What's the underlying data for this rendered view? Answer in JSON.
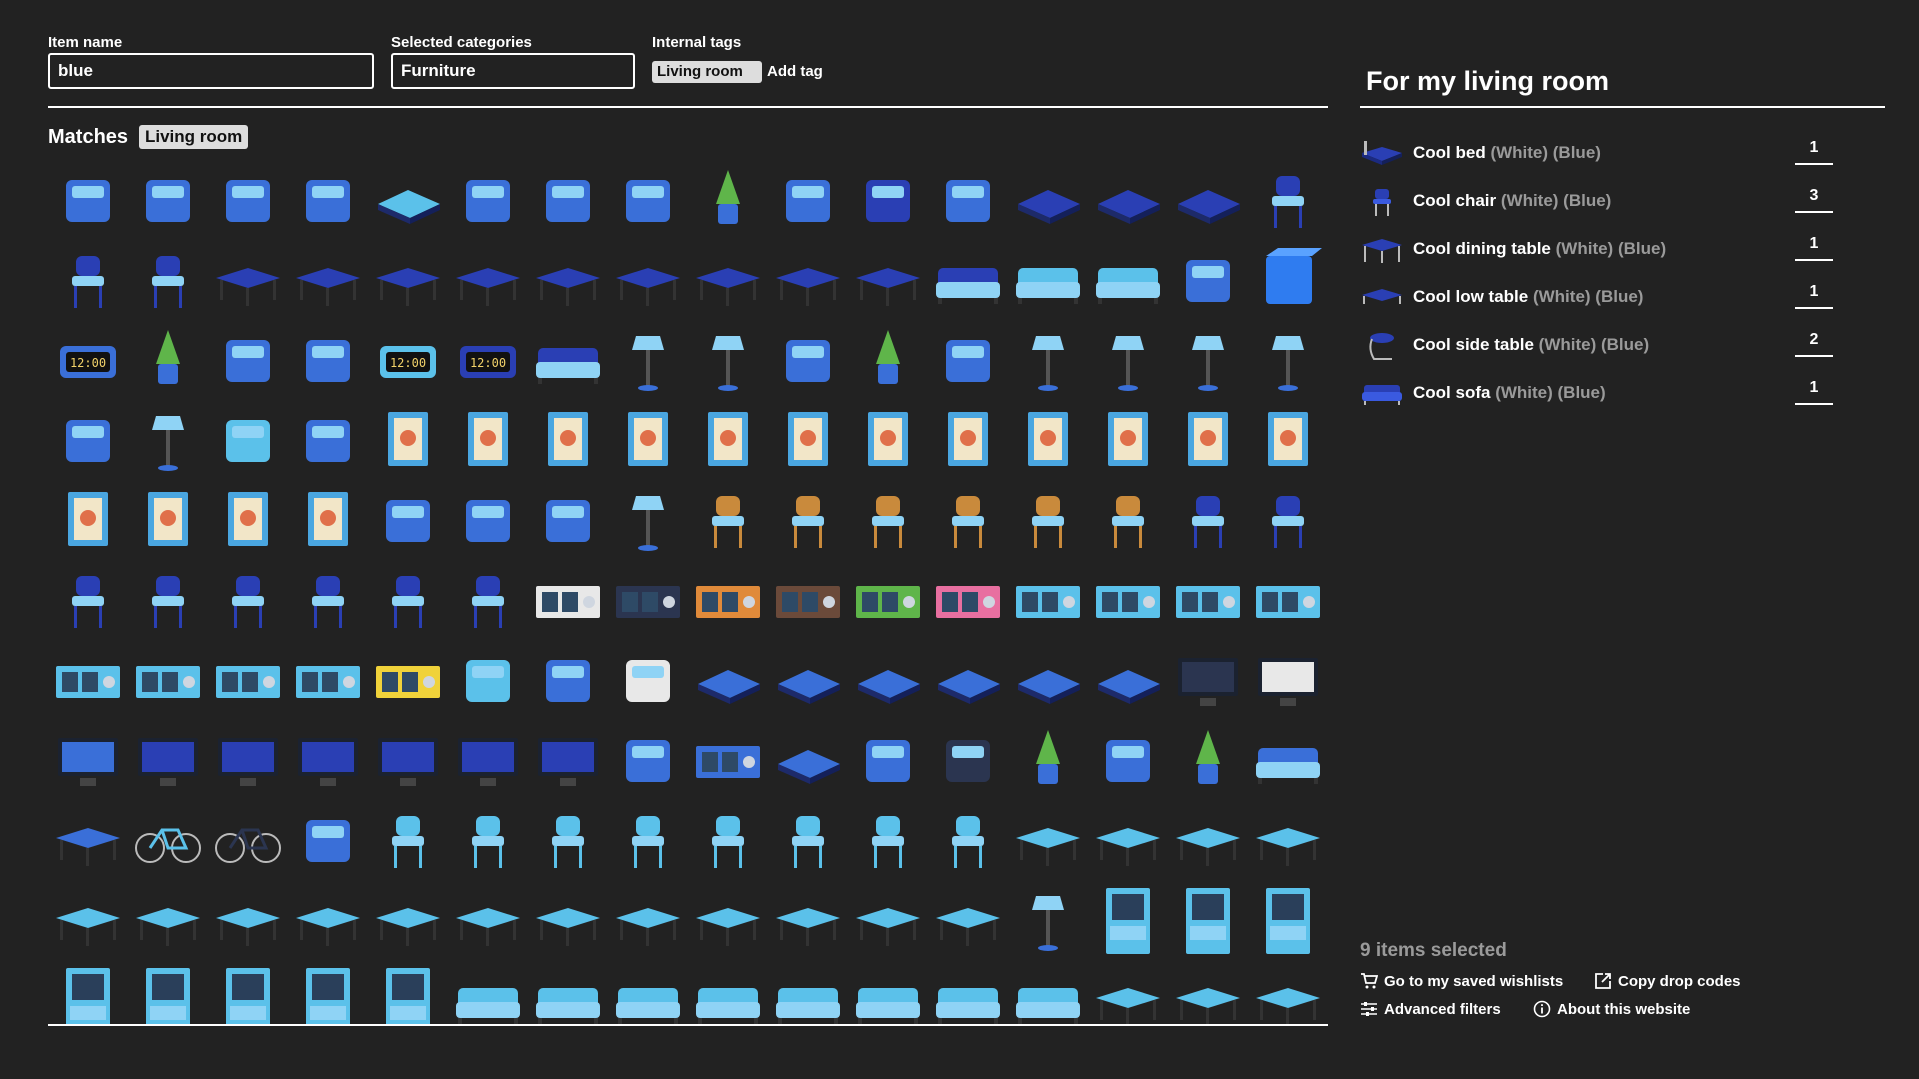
{
  "search": {
    "item_name_label": "Item name",
    "item_name_value": "blue",
    "categories_label": "Selected categories",
    "categories_value": "Furniture",
    "tags_label": "Internal tags",
    "tags": [
      "Living room"
    ],
    "add_tag_label": "Add tag"
  },
  "matches": {
    "title": "Matches",
    "active_tag": "Living room",
    "items": [
      "air-conditioner",
      "hanging-bird-mobile",
      "bird-feeder-stand",
      "welcome-mat",
      "teal-ottoman",
      "glass-tree-ornament",
      "blue-rug",
      "boombox",
      "potted-grass",
      "cat-tower",
      "blue-polka-wardrobe",
      "glass-case-cabinet",
      "cool-bed",
      "cool-bed-2",
      "cool-bed-3",
      "cool-chair",
      "cool-chair-2",
      "cool-chair-3",
      "cool-dining-table",
      "cool-dining-table-2",
      "cool-dining-table-3",
      "cool-low-table",
      "cool-low-table-2",
      "cool-low-table-3",
      "cool-side-table",
      "cool-side-table-2",
      "cool-side-table-3",
      "cool-sofa",
      "cool-sofa-2",
      "cool-sofa-3",
      "cordless-phone",
      "blue-cube",
      "cuckoo-clock",
      "potted-cypress",
      "seaplane-model",
      "standing-mirror",
      "digital-clock-teal",
      "digital-clock-blue",
      "blue-loveseat",
      "hanging-lights",
      "pendant-lamp",
      "electric-fan",
      "potted-palm",
      "fish-print-scroll",
      "floor-lamp-1",
      "floor-lamp-2",
      "floor-lamp-3",
      "floor-lamp-4",
      "hanging-flowers",
      "desk-lamp",
      "humidifier",
      "reed-diffuser",
      "framed-rose",
      "framed-sky",
      "framed-forest",
      "framed-bicycle",
      "framed-city",
      "framed-window",
      "framed-family",
      "framed-girl",
      "framed-flowers",
      "framed-notice",
      "framed-autumn",
      "framed-poster",
      "framed-poster-2",
      "framed-poster-3",
      "framed-bridge",
      "framed-map",
      "snowman-figure",
      "candle-glass",
      "hamster-cage",
      "blue-stand-light",
      "high-chair-1",
      "high-chair-2",
      "high-chair-3",
      "high-chair-4",
      "high-chair-5",
      "high-chair-6",
      "high-chair-7",
      "high-chair-8",
      "high-chair-9",
      "high-chair-10",
      "high-chair-11",
      "high-chair-12",
      "high-chair-13",
      "high-chair-14",
      "shelf-white",
      "shelf-black",
      "shelf-orange",
      "shelf-brown",
      "shelf-green",
      "shelf-pink",
      "shelf-blue-1",
      "shelf-blue-2",
      "shelf-blue-3",
      "shelf-blue-4",
      "shelf-blue-5",
      "shelf-blue-6",
      "shelf-blue-7",
      "shelf-blue-8",
      "shelf-yellow",
      "drop-humidifier",
      "knot-ornament",
      "ironing-board",
      "bed-1",
      "bed-2",
      "bed-3",
      "bed-4",
      "bed-5",
      "pet-bed",
      "tv-dark",
      "tv-white",
      "tv-wide",
      "laptop-1",
      "laptop-2",
      "laptop-3",
      "laptop-4",
      "laptop-5",
      "laptop-6",
      "macrame-hanging",
      "tall-shelf-panel",
      "floor-cushion",
      "teapot-blue",
      "teapot-dark",
      "potted-monstera",
      "round-pouf",
      "hanging-planter",
      "wicker-sofa",
      "round-side-table",
      "bicycle-teal",
      "bicycle-navy",
      "game-console",
      "armchair-1",
      "armchair-2",
      "armchair-3",
      "armchair-4",
      "armchair-5",
      "armchair-6",
      "armchair-7",
      "armchair-8",
      "coffee-table-1",
      "coffee-table-2",
      "coffee-table-3",
      "coffee-table-4",
      "coffee-table-5",
      "coffee-table-6",
      "coffee-table-7",
      "coffee-table-8",
      "tv-bench-1",
      "tv-bench-2",
      "tv-bench-3",
      "tv-bench-4",
      "tv-bench-5",
      "tv-bench-6",
      "tv-bench-7",
      "tv-bench-8",
      "blue-stand-light-2",
      "hutch-1",
      "hutch-2",
      "hutch-3",
      "hutch-4",
      "hutch-5",
      "hutch-6",
      "hutch-7",
      "hutch-8",
      "sofa-1",
      "sofa-2",
      "sofa-3",
      "sofa-4",
      "sofa-5",
      "sofa-6",
      "sofa-7",
      "sofa-8",
      "coffee-table-9",
      "coffee-table-10",
      "coffee-table-11"
    ]
  },
  "wishlist": {
    "title": "For my living room",
    "items": [
      {
        "name": "Cool bed",
        "variants": "(White) (Blue)",
        "qty": "1",
        "icon": "bed-icon"
      },
      {
        "name": "Cool chair",
        "variants": "(White) (Blue)",
        "qty": "3",
        "icon": "chair-icon"
      },
      {
        "name": "Cool dining table",
        "variants": "(White) (Blue)",
        "qty": "1",
        "icon": "dining-table-icon"
      },
      {
        "name": "Cool low table",
        "variants": "(White) (Blue)",
        "qty": "1",
        "icon": "low-table-icon"
      },
      {
        "name": "Cool side table",
        "variants": "(White) (Blue)",
        "qty": "2",
        "icon": "side-table-icon"
      },
      {
        "name": "Cool sofa",
        "variants": "(White) (Blue)",
        "qty": "1",
        "icon": "sofa-icon"
      }
    ]
  },
  "footer": {
    "selected_count": "9 items selected",
    "saved_wishlists": "Go to my saved wishlists",
    "copy_drop_codes": "Copy drop codes",
    "advanced_filters": "Advanced filters",
    "about": "About this website"
  },
  "colors": {
    "background": "#222222",
    "text": "#ffffff",
    "muted": "#9a9a9a",
    "chip": "#dddddd",
    "cool_blue": "#2a3fb4",
    "light_blue": "#5bc1ea"
  }
}
